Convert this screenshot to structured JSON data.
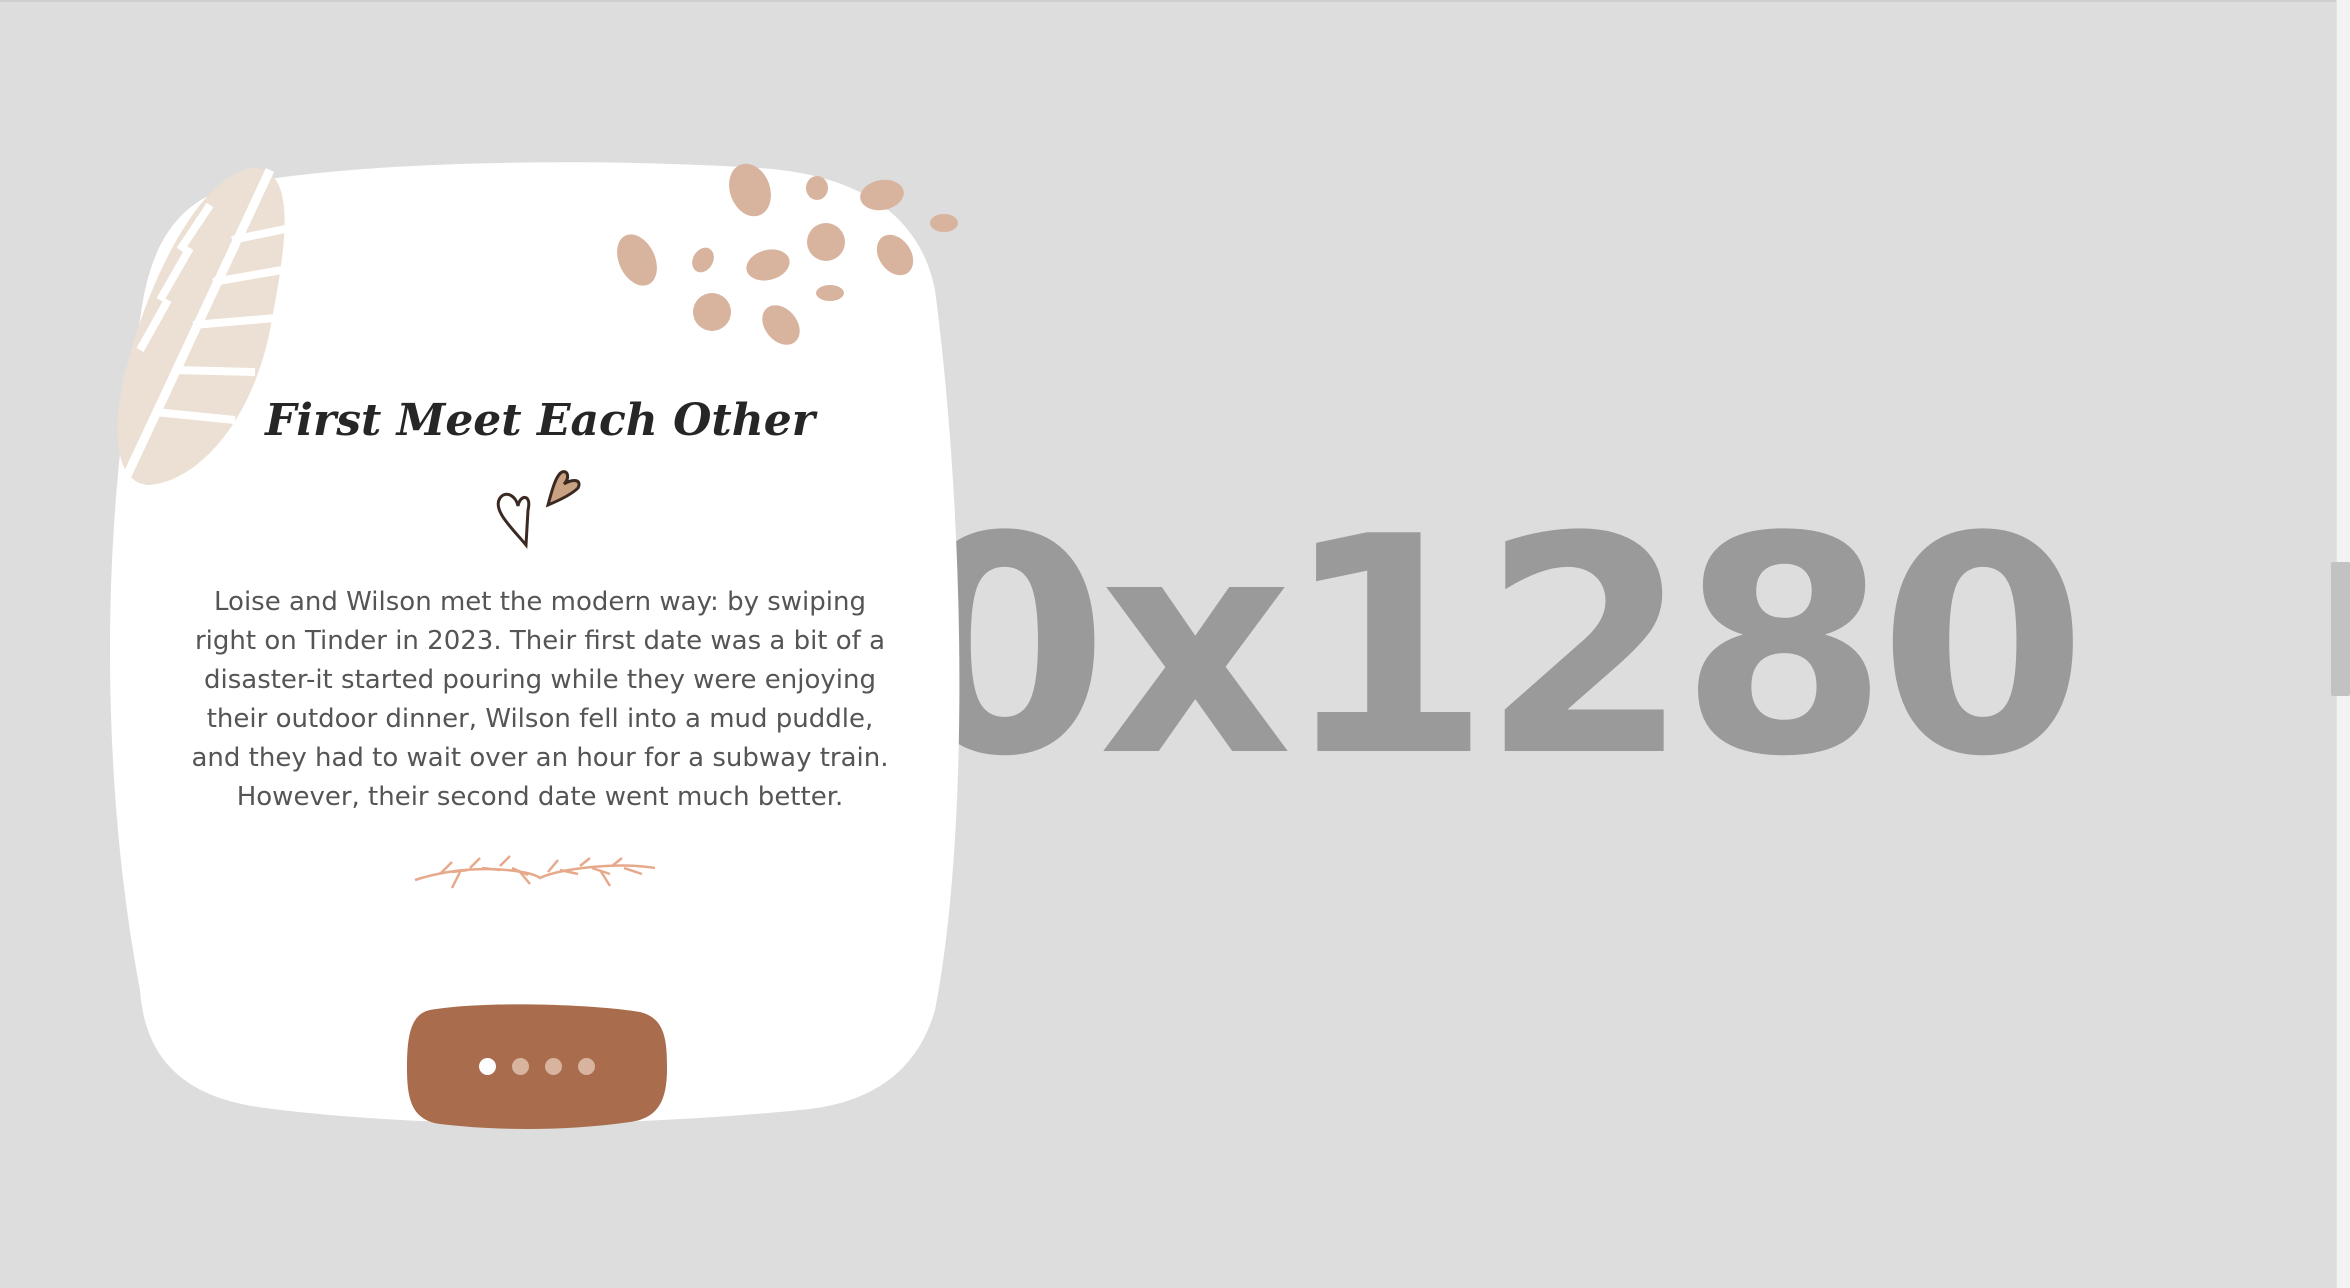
{
  "placeholder": {
    "text": "0x1280"
  },
  "card": {
    "title": "First Meet Each Other",
    "paragraph": "Loise and Wilson met the modern way: by swiping right on Tinder in 2023. Their first date was a bit of a disaster-it started pouring while they were enjoying their outdoor dinner, Wilson fell into a mud puddle, and they had to wait over an hour for a subway train. However, their second date went much better."
  },
  "slider": {
    "total_slides": 4,
    "active_index": 1
  },
  "colors": {
    "background": "#dddddd",
    "card": "#ffffff",
    "accent_brown": "#a96c4c",
    "beige_dots": "#d8b49f",
    "leaf": "#ecdfd3",
    "placeholder_text": "#9a9a9a"
  },
  "icons": [
    "leaf-decoration-icon",
    "pebbles-decoration-icon",
    "hearts-icon",
    "branch-divider-icon"
  ]
}
